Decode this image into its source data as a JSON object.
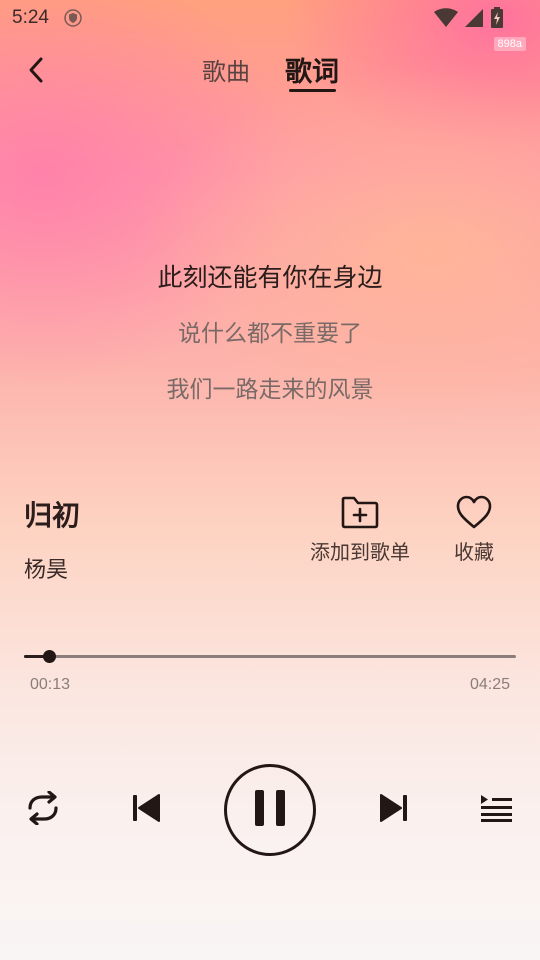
{
  "status_bar": {
    "time": "5:24",
    "debug_badge": "898a"
  },
  "header": {
    "tabs": [
      {
        "label": "歌曲",
        "active": false
      },
      {
        "label": "歌词",
        "active": true
      }
    ]
  },
  "lyrics": {
    "lines": [
      {
        "text": "此刻还能有你在身边",
        "current": true
      },
      {
        "text": "说什么都不重要了",
        "current": false
      },
      {
        "text": "我们一路走来的风景",
        "current": false
      }
    ]
  },
  "song": {
    "title": "归初",
    "artist": "杨昊"
  },
  "actions": {
    "add_to_playlist_label": "添加到歌单",
    "favorite_label": "收藏"
  },
  "progress": {
    "current_time": "00:13",
    "total_time": "04:25",
    "fraction": 0.051
  },
  "icons": {
    "status": [
      "shield-icon",
      "wifi-icon",
      "signal-icon",
      "battery-charging-icon"
    ],
    "controls": [
      "repeat-icon",
      "previous-icon",
      "pause-icon",
      "next-icon",
      "playlist-icon"
    ]
  },
  "colors": {
    "accent": "#221714",
    "secondary_text": "#7a6a67"
  }
}
